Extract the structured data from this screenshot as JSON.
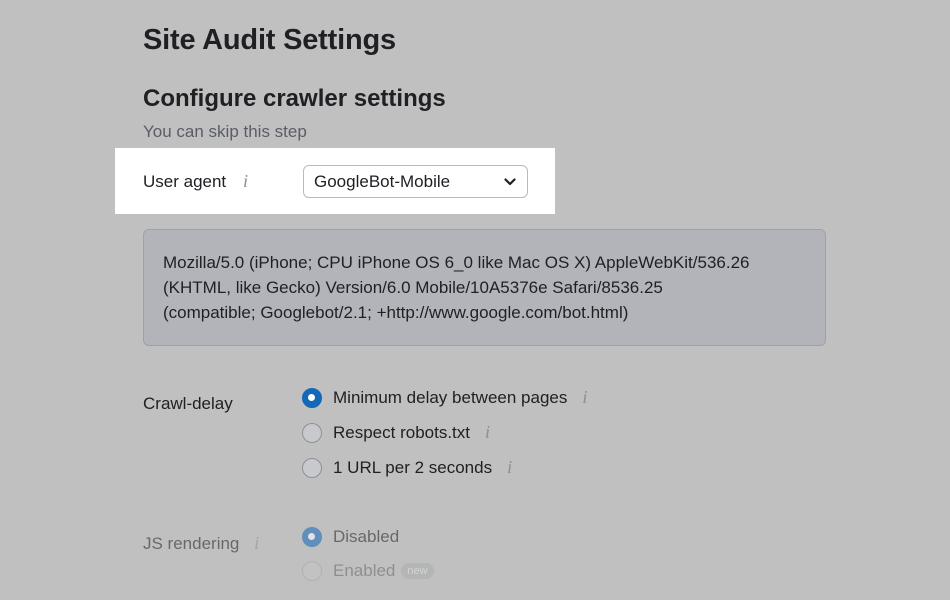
{
  "page_title": "Site Audit Settings",
  "section_title": "Configure crawler settings",
  "skip_hint": "You can skip this step",
  "user_agent": {
    "label": "User agent",
    "info_icon": "i",
    "selected": "GoogleBot-Mobile",
    "string_lines": [
      "Mozilla/5.0 (iPhone; CPU iPhone OS 6_0 like Mac OS X) AppleWebKit/536.26",
      "(KHTML, like Gecko) Version/6.0 Mobile/10A5376e Safari/8536.25",
      "(compatible; Googlebot/2.1; +http://www.google.com/bot.html)"
    ]
  },
  "crawl_delay": {
    "label": "Crawl-delay",
    "options": [
      {
        "label": "Minimum delay between pages",
        "checked": true
      },
      {
        "label": "Respect robots.txt",
        "checked": false
      },
      {
        "label": "1 URL per 2 seconds",
        "checked": false
      }
    ]
  },
  "js_rendering": {
    "label": "JS rendering",
    "options": [
      {
        "label": "Disabled",
        "checked": true
      },
      {
        "label": "Enabled",
        "checked": false,
        "badge": "new"
      }
    ]
  },
  "colors": {
    "background": "#c0c0c0",
    "highlight": "#ffffff",
    "radio_checked": "#1468b8"
  }
}
